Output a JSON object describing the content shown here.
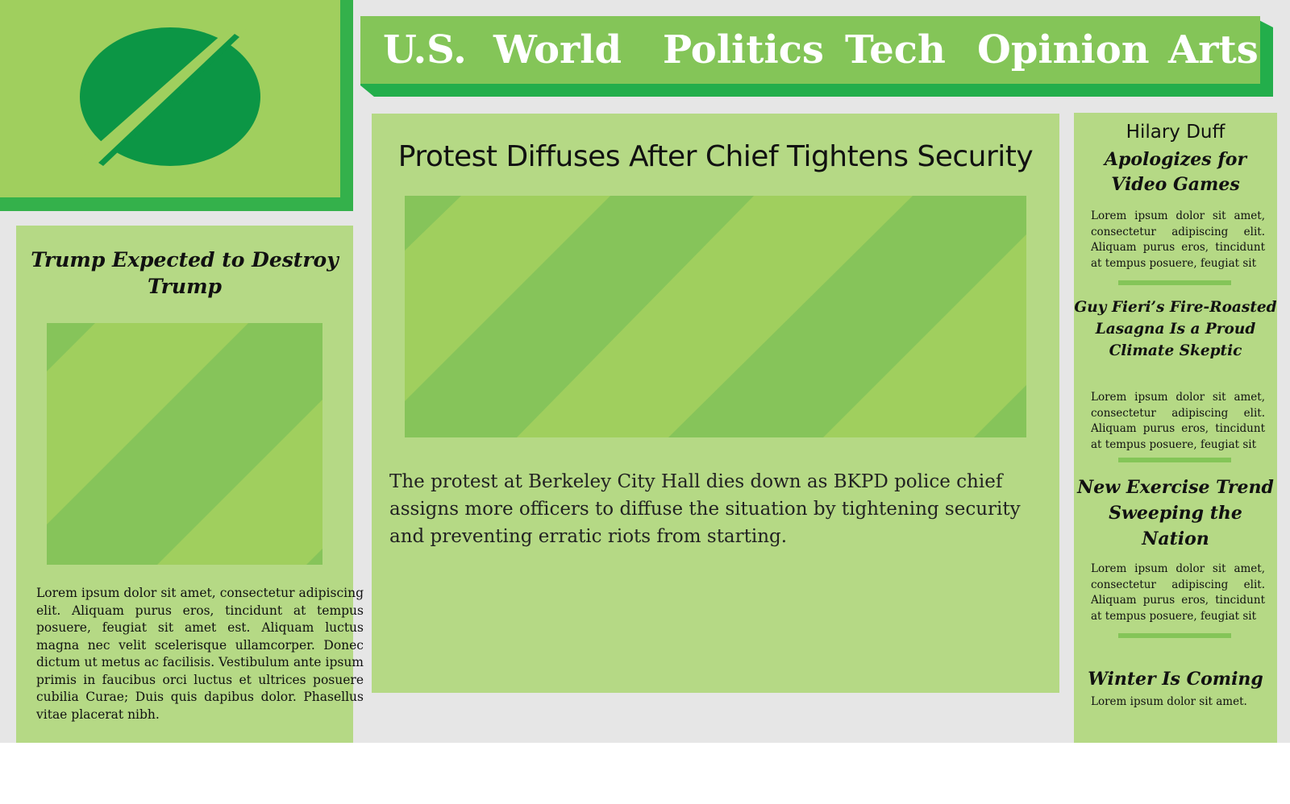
{
  "colors": {
    "page_bg": "#e6e6e6",
    "panel": "#b5d985",
    "nav": "#84c558",
    "nav_shadow": "#23ae4b",
    "logo_bg": "#a0cf5e",
    "logo_mark": "#0c9645",
    "stripe_light": "#a0cf5e",
    "stripe_dark": "#86c45a"
  },
  "logo": {
    "icon": "leaf-logo-icon"
  },
  "nav": {
    "items": [
      {
        "label": "U.S."
      },
      {
        "label": "World"
      },
      {
        "label": "Politics"
      },
      {
        "label": "Tech"
      },
      {
        "label": "Opinion"
      },
      {
        "label": "Arts"
      }
    ]
  },
  "left_story": {
    "title": "Trump Expected to Destroy Trump",
    "image": "image-placeholder",
    "body": "Lorem ipsum dolor sit amet, consectetur adipiscing elit. Aliquam purus eros, tincidunt at tempus posuere, feugiat sit amet est. Aliquam luctus magna nec velit scelerisque ullamcorper. Donec dictum ut metus ac facilisis. Vestibulum ante ipsum primis in faucibus orci luctus et ultrices posuere cubilia Curae; Duis quis dapibus dolor. Phasellus vitae placerat nibh."
  },
  "main_story": {
    "title": "Protest Diffuses After Chief Tightens Security",
    "image": "image-placeholder",
    "body": "The protest at Berkeley City Hall dies down as BKPD police chief assigns more officers to diffuse the situation by tightening security and preventing erratic riots from starting."
  },
  "sidebar": {
    "items": [
      {
        "kicker": "Hilary Duff",
        "title": "Apologizes for Video Games",
        "body": "Lorem ipsum dolor sit amet, consectetur adipiscing elit. Aliquam purus eros, tincidunt at tempus posuere, feugiat sit"
      },
      {
        "title": "Guy Fieri’s Fire-Roasted Lasagna Is a Proud Climate Skeptic",
        "body": "Lorem ipsum dolor sit amet, consectetur adipiscing elit. Aliquam purus eros, tincidunt at tempus posuere, feugiat sit"
      },
      {
        "title": "New Exercise Trend Sweeping the Nation",
        "body": "Lorem ipsum dolor sit amet, consectetur adipiscing elit. Aliquam purus eros, tincidunt at tempus posuere, feugiat sit"
      },
      {
        "title": "Winter Is Coming",
        "body": "Lorem ipsum dolor sit amet."
      }
    ]
  }
}
